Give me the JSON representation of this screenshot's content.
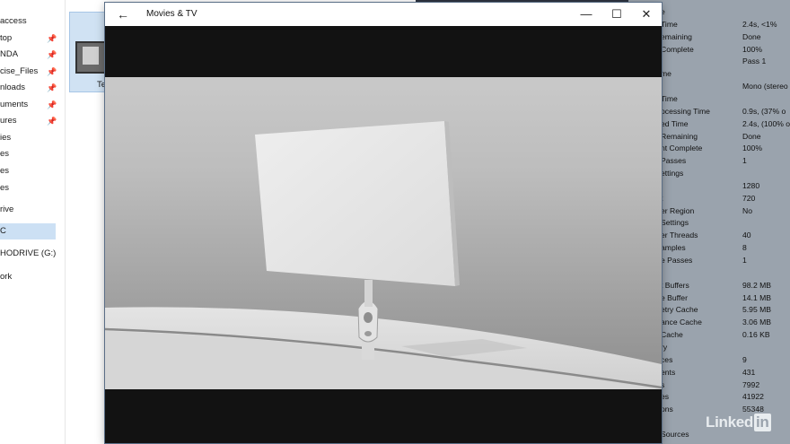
{
  "explorer": {
    "nav": [
      {
        "label": "access",
        "pinned": false
      },
      {
        "label": "top",
        "pinned": true
      },
      {
        "label": "NDA",
        "pinned": true
      },
      {
        "label": "cise_Files",
        "pinned": true
      },
      {
        "label": "nloads",
        "pinned": true
      },
      {
        "label": "uments",
        "pinned": true
      },
      {
        "label": "ures",
        "pinned": true
      },
      {
        "label": "ies",
        "pinned": false
      },
      {
        "label": "es",
        "pinned": false
      },
      {
        "label": "es",
        "pinned": false
      },
      {
        "label": "es",
        "pinned": false
      },
      {
        "label": "rive",
        "pinned": false
      },
      {
        "label": "C",
        "pinned": false,
        "selected": true
      },
      {
        "label": "HODRIVE (G:)",
        "pinned": false
      },
      {
        "label": "ork",
        "pinned": false
      }
    ],
    "pin_glyph": "📌",
    "file_label": "Te"
  },
  "player": {
    "title": "Movies & TV",
    "back_glyph": "←",
    "minimize_glyph": "—",
    "maximize_glyph": "☐",
    "close_glyph": "✕"
  },
  "render_panel": {
    "rows": [
      {
        "label": "e",
        "value": ""
      },
      {
        "label": "Time",
        "value": "2.4s, <1%"
      },
      {
        "label": "emaining",
        "value": "Done"
      },
      {
        "label": "Complete",
        "value": "100%"
      },
      {
        "label": "",
        "value": "Pass 1"
      },
      {
        "label": "me",
        "value": ""
      },
      {
        "label": "",
        "value": "Mono (stereo"
      },
      {
        "label": "Time",
        "value": ""
      },
      {
        "label": "ocessing Time",
        "value": "0.9s, (37% o"
      },
      {
        "label": "ed Time",
        "value": "2.4s, (100% o"
      },
      {
        "label": "Remaining",
        "value": "Done"
      },
      {
        "label": "nt Complete",
        "value": "100%"
      },
      {
        "label": "Passes",
        "value": "1"
      },
      {
        "label": "ettings",
        "value": ""
      },
      {
        "label": "",
        "value": "1280"
      },
      {
        "label": "t",
        "value": "720"
      },
      {
        "label": "er Region",
        "value": "No"
      },
      {
        "label": "Settings",
        "value": ""
      },
      {
        "label": "er Threads",
        "value": "40"
      },
      {
        "label": "amples",
        "value": "8"
      },
      {
        "label": "e Passes",
        "value": "1"
      },
      {
        "label": "",
        "value": ""
      },
      {
        "label": "t Buffers",
        "value": "98.2 MB"
      },
      {
        "label": "e Buffer",
        "value": "14.1 MB"
      },
      {
        "label": "etry Cache",
        "value": "5.95 MB"
      },
      {
        "label": "ance Cache",
        "value": "3.06 MB"
      },
      {
        "label": "Cache",
        "value": "0.16 KB"
      },
      {
        "label": "ry",
        "value": ""
      },
      {
        "label": "ces",
        "value": "9"
      },
      {
        "label": "ents",
        "value": "431"
      },
      {
        "label": "s",
        "value": "7992"
      },
      {
        "label": "es",
        "value": "41922"
      },
      {
        "label": "ons",
        "value": "55348"
      },
      {
        "label": "",
        "value": ""
      },
      {
        "label": "Sources",
        "value": ""
      }
    ]
  },
  "watermark": {
    "text": "Linked",
    "boxed": "in"
  }
}
